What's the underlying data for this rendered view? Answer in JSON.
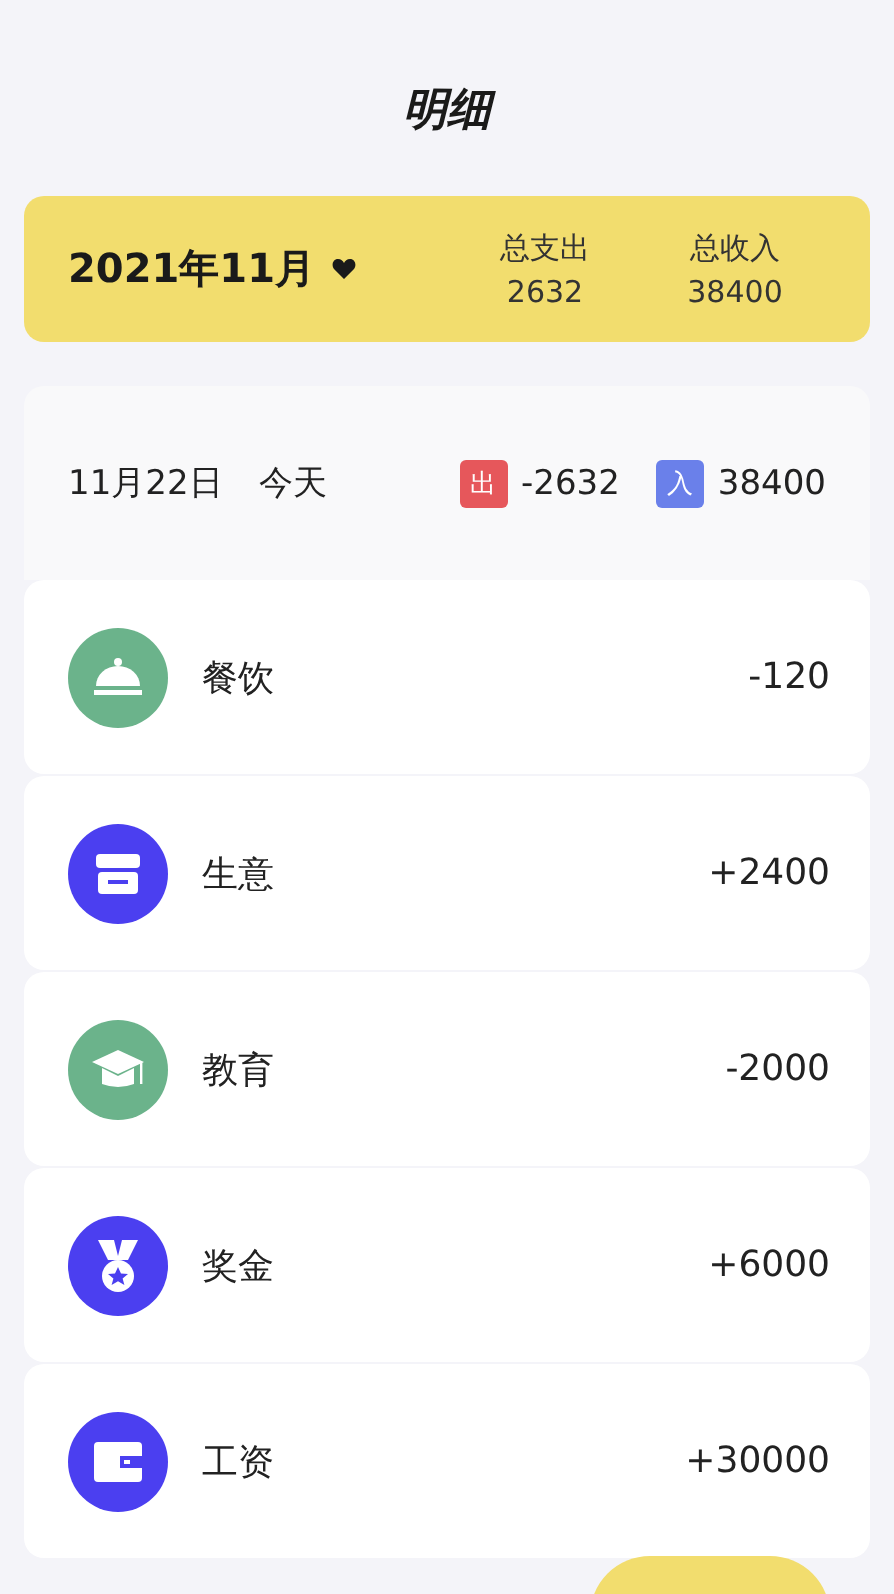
{
  "title": "明细",
  "summary": {
    "month": "2021年11月",
    "expense_label": "总支出",
    "expense": "2632",
    "income_label": "总收入",
    "income": "38400"
  },
  "day": {
    "date": "11月22日",
    "relative": "今天",
    "out_badge": "出",
    "out": "-2632",
    "in_badge": "入",
    "in": "38400"
  },
  "entries": [
    {
      "kind": "food",
      "color": "#6bb38b",
      "name": "餐饮",
      "amount": "-120"
    },
    {
      "kind": "shop",
      "color": "#4b3ff0",
      "name": "生意",
      "amount": "+2400"
    },
    {
      "kind": "education",
      "color": "#6bb38b",
      "name": "教育",
      "amount": "-2000"
    },
    {
      "kind": "medal",
      "color": "#4b3ff0",
      "name": "奖金",
      "amount": "+6000"
    },
    {
      "kind": "wallet",
      "color": "#4b3ff0",
      "name": "工资",
      "amount": "+30000"
    }
  ]
}
